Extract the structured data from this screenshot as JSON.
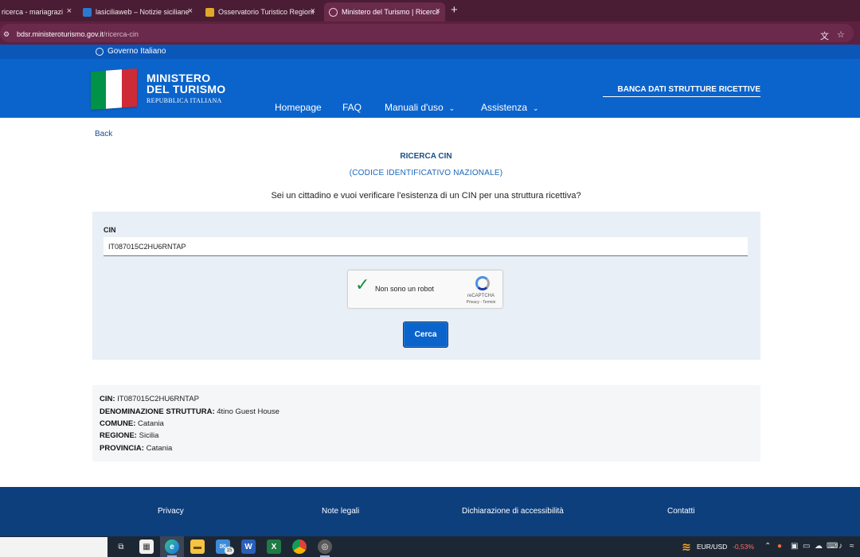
{
  "browser": {
    "tabs": [
      {
        "title": "ricerca - mariagrazi",
        "active": false
      },
      {
        "title": "lasiciliaweb – Notizie siciliane",
        "active": false
      },
      {
        "title": "Osservatorio Turistico Regione",
        "active": false
      },
      {
        "title": "Ministero del Turismo | Ricerca",
        "active": true
      }
    ],
    "new_tab": "+",
    "close_glyph": "×",
    "url_domain": "bdsr.ministeroturismo.gov.it",
    "url_path": "/ricerca-cin"
  },
  "gov_strip": {
    "label": "Governo Italiano"
  },
  "header": {
    "brand_line1": "MINISTERO",
    "brand_line2": "DEL TURISMO",
    "brand_line3": "REPUBBLICA ITALIANA",
    "nav": [
      {
        "label": "Homepage"
      },
      {
        "label": "FAQ"
      },
      {
        "label": "Manuali d'uso"
      },
      {
        "label": "Assistenza"
      }
    ],
    "section_title": "BANCA DATI STRUTTURE RICETTIVE"
  },
  "page": {
    "back": "Back",
    "title": "RICERCA CIN",
    "subtitle": "(CODICE IDENTIFICATIVO NAZIONALE)",
    "question": "Sei un cittadino e vuoi verificare l'esistenza di un CIN per una struttura ricettiva?"
  },
  "form": {
    "cin_label": "CIN",
    "cin_value": "IT087015C2HU6RNTAP",
    "recaptcha_label": "Non sono un robot",
    "recaptcha_brand": "reCAPTCHA",
    "recaptcha_links": "Privacy - Termini",
    "recaptcha_checked": true,
    "submit": "Cerca"
  },
  "result": {
    "rows": [
      {
        "label": "CIN:",
        "value": "IT087015C2HU6RNTAP"
      },
      {
        "label": "DENOMINAZIONE STRUTTURA:",
        "value": "4tino Guest House"
      },
      {
        "label": "COMUNE:",
        "value": "Catania"
      },
      {
        "label": "REGIONE:",
        "value": "Sicilia"
      },
      {
        "label": "PROVINCIA:",
        "value": "Catania"
      }
    ]
  },
  "footer": {
    "links": [
      {
        "label": "Privacy"
      },
      {
        "label": "Note legali"
      },
      {
        "label": "Dichiarazione di accessibilità"
      },
      {
        "label": "Contatti"
      }
    ]
  },
  "taskbar": {
    "edge_badge": "15",
    "ticker_label": "EUR/USD",
    "ticker_value": "-0,53%"
  },
  "colors": {
    "primary_blue": "#0b64cc",
    "footer_blue": "#0d3f7d",
    "browser_chrome": "#4a1d34",
    "flag_green": "#009246",
    "flag_white": "#ffffff",
    "flag_red": "#ce2b37"
  }
}
